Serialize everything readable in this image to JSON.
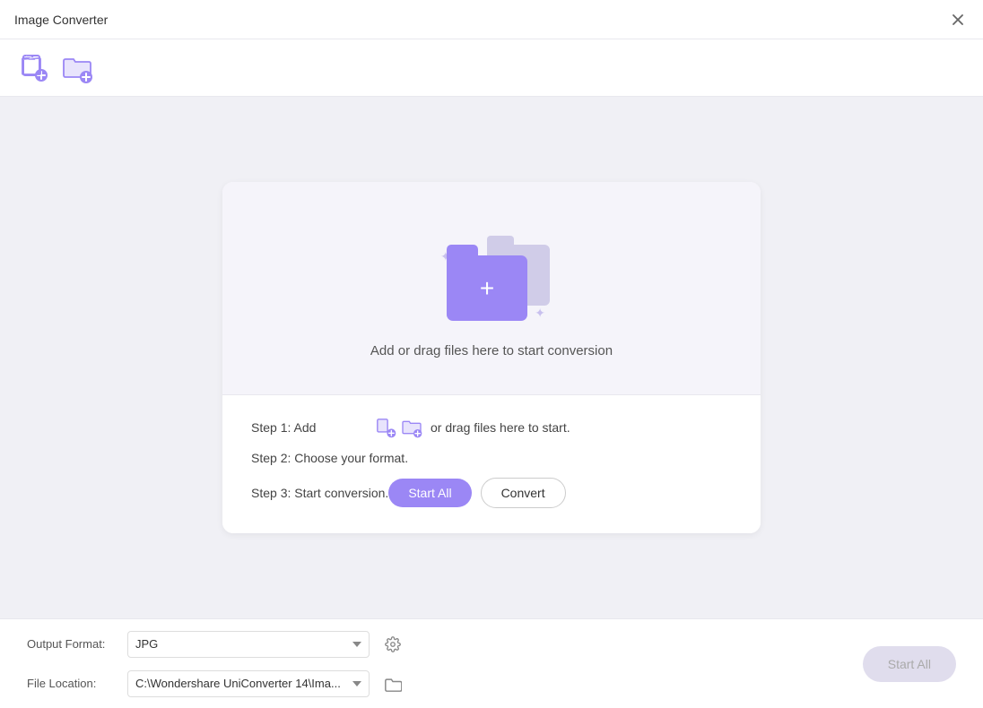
{
  "window": {
    "title": "Image Converter"
  },
  "toolbar": {
    "add_file_icon": "add-file-icon",
    "add_folder_icon": "add-folder-icon"
  },
  "drop_zone": {
    "instruction_text": "Add or drag files here to start conversion",
    "folder_plus_symbol": "+"
  },
  "steps": {
    "step1_label": "Step 1: Add",
    "step1_suffix": "or drag files here to start.",
    "step2_label": "Step 2: Choose your format.",
    "step3_label": "Step 3: Start conversion.",
    "start_all_btn": "Start All",
    "convert_btn": "Convert"
  },
  "bottom_bar": {
    "output_format_label": "Output Format:",
    "output_format_value": "JPG",
    "file_location_label": "File Location:",
    "file_location_value": "C:\\Wondershare UniConverter 14\\Ima...",
    "start_all_btn": "Start All"
  },
  "colors": {
    "purple": "#9b87f5",
    "purple_light": "#d0cce8",
    "bg": "#f0f0f5",
    "white": "#ffffff"
  }
}
